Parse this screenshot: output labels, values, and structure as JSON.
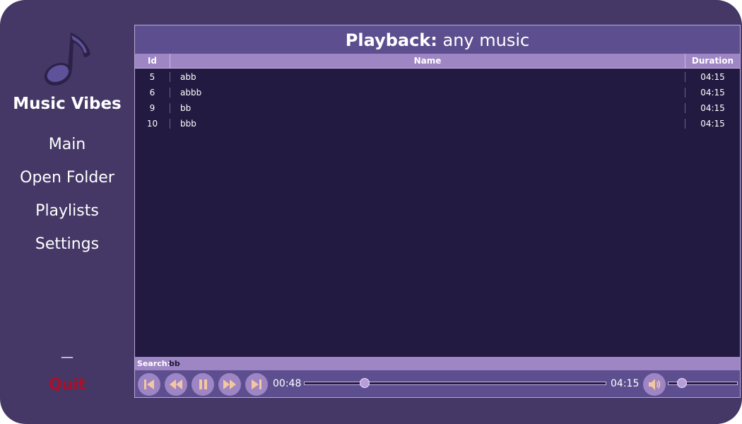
{
  "app": {
    "title": "Music Vibes"
  },
  "nav": [
    {
      "label": "Main"
    },
    {
      "label": "Open Folder"
    },
    {
      "label": "Playlists"
    },
    {
      "label": "Settings"
    }
  ],
  "window_controls": {
    "minimize": "—",
    "quit": "Quit"
  },
  "playback": {
    "prefix": "Playback:",
    "name": "any music"
  },
  "table": {
    "columns": [
      "Id",
      "Name",
      "Duration"
    ],
    "rows": [
      {
        "id": "5",
        "name": "abb",
        "duration": "04:15"
      },
      {
        "id": "6",
        "name": "abbb",
        "duration": "04:15"
      },
      {
        "id": "9",
        "name": "bb",
        "duration": "04:15"
      },
      {
        "id": "10",
        "name": "bbb",
        "duration": "04:15"
      }
    ]
  },
  "search": {
    "label": "Search:",
    "value": "bb"
  },
  "player": {
    "current_time": "00:48",
    "total_time": "04:15",
    "progress": 0.2,
    "volume": 0.2
  },
  "colors": {
    "background": "#453866",
    "header": "#5d4f8f",
    "list_bg": "#231a42",
    "accent": "#9e85c4",
    "icon": "#f3c7a0",
    "quit": "#a8102a"
  },
  "icons": {
    "logo": "music-note-icon",
    "prev": "skip-previous-icon",
    "rewind": "rewind-icon",
    "pause": "pause-icon",
    "forward": "fast-forward-icon",
    "next": "skip-next-icon",
    "volume": "volume-icon"
  }
}
